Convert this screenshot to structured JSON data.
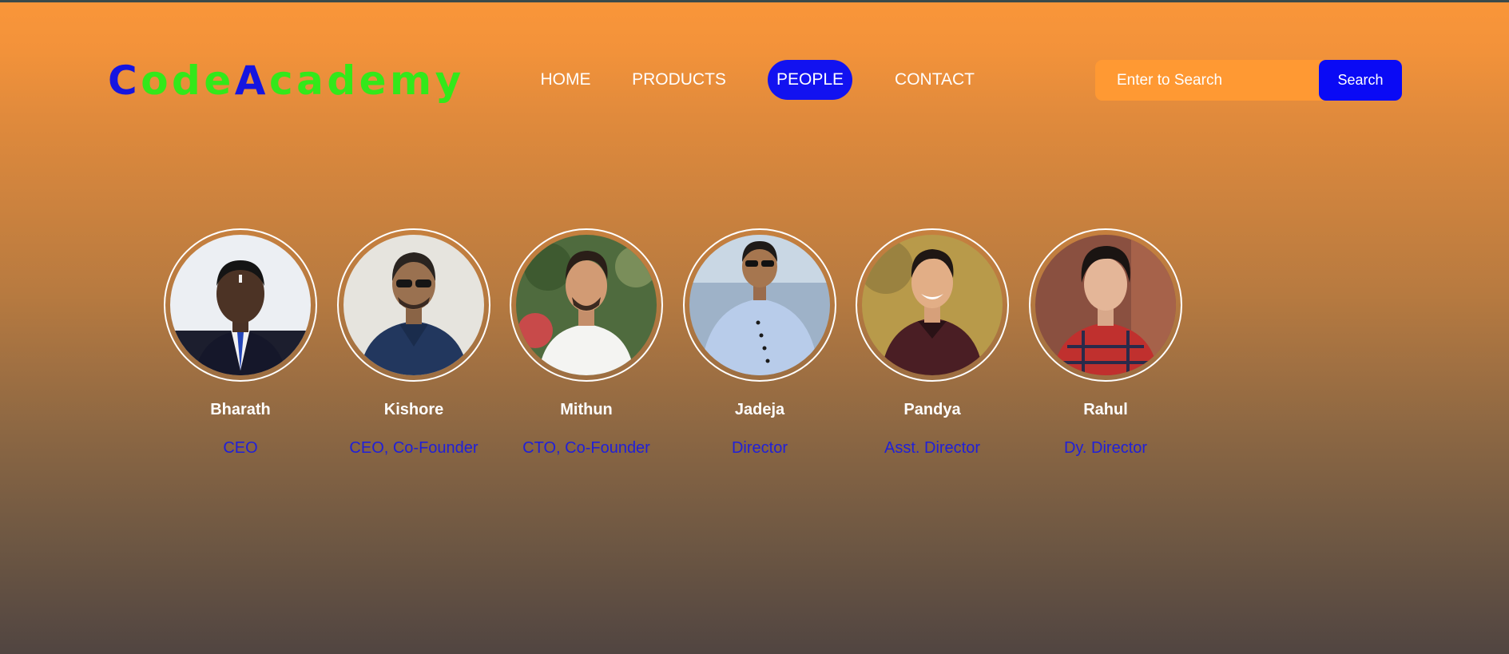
{
  "logo": {
    "parts": [
      {
        "text": "C",
        "color": "#1515E0"
      },
      {
        "text": "ode",
        "color": "#33E81A"
      },
      {
        "text": "A",
        "color": "#1515E0"
      },
      {
        "text": "cademy",
        "color": "#33E81A"
      }
    ]
  },
  "nav": {
    "items": [
      {
        "label": "HOME",
        "active": false
      },
      {
        "label": "PRODUCTS",
        "active": false
      },
      {
        "label": "PEOPLE",
        "active": true
      },
      {
        "label": "CONTACT",
        "active": false
      }
    ]
  },
  "search": {
    "placeholder": "Enter to Search",
    "value": "",
    "button_label": "Search"
  },
  "people": [
    {
      "name": "Bharath",
      "role": "CEO",
      "photo": "person-photo"
    },
    {
      "name": "Kishore",
      "role": "CEO, Co-Founder",
      "photo": "person-photo"
    },
    {
      "name": "Mithun",
      "role": "CTO, Co-Founder",
      "photo": "person-photo"
    },
    {
      "name": "Jadeja",
      "role": "Director",
      "photo": "person-photo"
    },
    {
      "name": "Pandya",
      "role": "Asst. Director",
      "photo": "person-photo"
    },
    {
      "name": "Rahul",
      "role": "Dy. Director",
      "photo": "person-photo"
    }
  ],
  "colors": {
    "accent_blue": "#1212F0",
    "logo_green": "#33E81A",
    "search_bg": "#FF9933",
    "role_text": "#2020D8"
  }
}
